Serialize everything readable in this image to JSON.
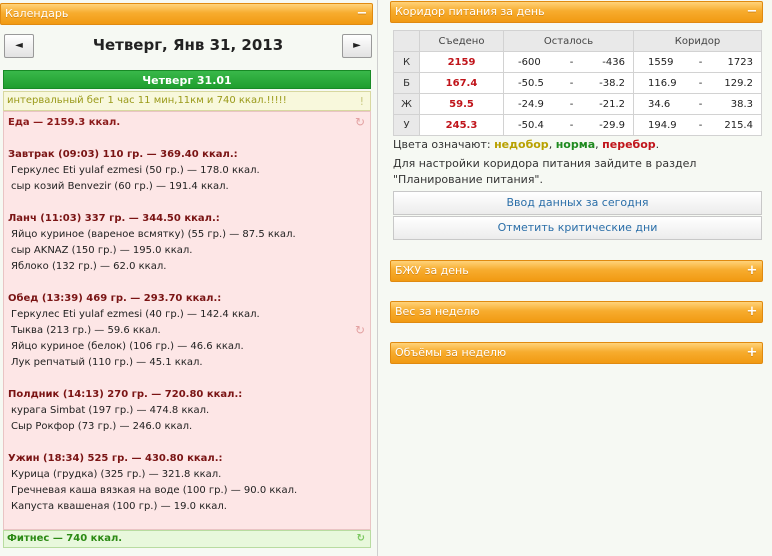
{
  "calendar": {
    "header": "Календарь",
    "toggle": "−",
    "prev": "◄",
    "next": "►",
    "date_title": "Четверг, Янв 31, 2013",
    "day_bar": "Четверг 31.01",
    "note": "интервальный бег 1 час 11 мин,11км и 740 ккал.!!!!!",
    "note_mark": "!",
    "food": [
      {
        "type": "total",
        "text": "Еда — 2159.3 ккал."
      },
      {
        "type": "gap"
      },
      {
        "type": "meal",
        "text": "Завтрак (09:03) 110 гр. — 369.40 ккал.:"
      },
      {
        "type": "item",
        "text": "Геркулес Eti yulaf ezmesi (50 гр.) — 178.0 ккал."
      },
      {
        "type": "item",
        "text": "сыр козий Benvezir (60 гр.) — 191.4 ккал."
      },
      {
        "type": "gap"
      },
      {
        "type": "meal",
        "text": "Ланч (11:03) 337 гр. — 344.50 ккал.:"
      },
      {
        "type": "item",
        "text": "Яйцо куриное (вареное всмятку) (55 гр.) — 87.5 ккал."
      },
      {
        "type": "item",
        "text": "сыр AKNAZ (150 гр.) — 195.0 ккал."
      },
      {
        "type": "item",
        "text": "Яблоко (132 гр.) — 62.0 ккал."
      },
      {
        "type": "gap"
      },
      {
        "type": "meal",
        "text": "Обед (13:39) 469 гр. — 293.70 ккал.:"
      },
      {
        "type": "item",
        "text": "Геркулес Eti yulaf ezmesi (40 гр.) — 142.4 ккал."
      },
      {
        "type": "item",
        "text": "Тыква (213 гр.) — 59.6 ккал."
      },
      {
        "type": "item",
        "text": "Яйцо куриное (белок) (106 гр.) — 46.6 ккал."
      },
      {
        "type": "item",
        "text": "Лук репчатый (110 гр.) — 45.1 ккал."
      },
      {
        "type": "gap"
      },
      {
        "type": "meal",
        "text": "Полдник (14:13) 270 гр. — 720.80 ккал.:"
      },
      {
        "type": "item",
        "text": "курага Simbat (197 гр.) — 474.8 ккал."
      },
      {
        "type": "item",
        "text": "Сыр Рокфор (73 гр.) — 246.0 ккал."
      },
      {
        "type": "gap"
      },
      {
        "type": "meal",
        "text": "Ужин (18:34) 525 гр. — 430.80 ккал.:"
      },
      {
        "type": "item",
        "text": "Курица (грудка) (325 гр.) — 321.8 ккал."
      },
      {
        "type": "item",
        "text": "Гречневая каша вязкая на воде (100 гр.) — 90.0 ккал."
      },
      {
        "type": "item",
        "text": "Капуста квашеная (100 гр.) — 19.0 ккал."
      }
    ],
    "fitness": "Фитнес — 740 ккал.",
    "fitness_icon": "↻"
  },
  "corridor": {
    "header": "Коридор питания за день",
    "toggle": "−",
    "columns": [
      "Съедено",
      "Осталось",
      "Коридор"
    ],
    "rows": [
      {
        "label": "К",
        "eaten": "2159",
        "rem_a": "-600",
        "rem_sep": "-",
        "rem_b": "-436",
        "cor_a": "1559",
        "cor_sep": "-",
        "cor_b": "1723"
      },
      {
        "label": "Б",
        "eaten": "167.4",
        "rem_a": "-50.5",
        "rem_sep": "-",
        "rem_b": "-38.2",
        "cor_a": "116.9",
        "cor_sep": "-",
        "cor_b": "129.2"
      },
      {
        "label": "Ж",
        "eaten": "59.5",
        "rem_a": "-24.9",
        "rem_sep": "-",
        "rem_b": "-21.2",
        "cor_a": "34.6",
        "cor_sep": "-",
        "cor_b": "38.3"
      },
      {
        "label": "У",
        "eaten": "245.3",
        "rem_a": "-50.4",
        "rem_sep": "-",
        "rem_b": "-29.9",
        "cor_a": "194.9",
        "cor_sep": "-",
        "cor_b": "215.4"
      }
    ],
    "legend_prefix": "Цвета означают:",
    "legend_under": "недобор",
    "legend_norm": "норма",
    "legend_over": "перебор",
    "legend_comma1": ",",
    "legend_comma2": ",",
    "legend_dot": ".",
    "hint": "Для настройки коридора питания зайдите в раздел \"Планирование питания\".",
    "btn_enter": "Ввод данных за сегодня",
    "btn_critical": "Отметить критические дни"
  },
  "panels": [
    {
      "header": "БЖУ за день",
      "toggle": "+"
    },
    {
      "header": "Вес за неделю",
      "toggle": "+"
    },
    {
      "header": "Объёмы за неделю",
      "toggle": "+"
    }
  ],
  "colors": {
    "accent_orange": "#f7ac2e",
    "day_green": "#1f9e2e",
    "over_red": "#c0141a",
    "link_blue": "#2a6ea8"
  }
}
